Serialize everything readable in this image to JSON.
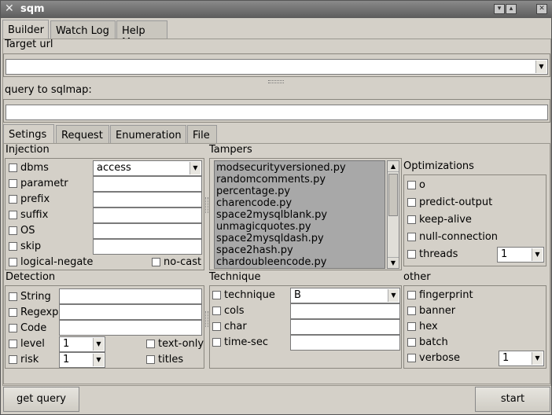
{
  "window": {
    "title": "sqm"
  },
  "main_tabs": [
    "Builder",
    "Watch Log",
    "Help Me"
  ],
  "target_url": {
    "label": "Target url",
    "value": ""
  },
  "query": {
    "label": "query to sqlmap:",
    "value": ""
  },
  "sub_tabs": [
    "Setings",
    "Request",
    "Enumeration",
    "File"
  ],
  "injection": {
    "title": "Injection",
    "dbms_label": "dbms",
    "dbms_value": "access",
    "parametr_label": "parametr",
    "prefix_label": "prefix",
    "suffix_label": "suffix",
    "os_label": "OS",
    "skip_label": "skip",
    "logical_negate_label": "logical-negate",
    "no_cast_label": "no-cast"
  },
  "tampers": {
    "title": "Tampers",
    "items": [
      "modsecurityversioned.py",
      "randomcomments.py",
      "percentage.py",
      "charencode.py",
      "space2mysqlblank.py",
      "unmagicquotes.py",
      "space2mysqldash.py",
      "space2hash.py",
      "chardoubleencode.py"
    ]
  },
  "optimizations": {
    "title": "Optimizations",
    "o_label": "o",
    "predict_output_label": "predict-output",
    "keep_alive_label": "keep-alive",
    "null_connection_label": "null-connection",
    "threads_label": "threads",
    "threads_value": "1"
  },
  "detection": {
    "title": "Detection",
    "string_label": "String",
    "regexp_label": "Regexp",
    "code_label": "Code",
    "level_label": "level",
    "level_value": "1",
    "risk_label": "risk",
    "risk_value": "1",
    "text_only_label": "text-only",
    "titles_label": "titles"
  },
  "technique": {
    "title": "Technique",
    "technique_label": "technique",
    "technique_value": "B",
    "cols_label": "cols",
    "char_label": "char",
    "time_sec_label": "time-sec"
  },
  "other": {
    "title": "other",
    "fingerprint_label": "fingerprint",
    "banner_label": "banner",
    "hex_label": "hex",
    "batch_label": "batch",
    "verbose_label": "verbose",
    "verbose_value": "1"
  },
  "buttons": {
    "get_query": "get query",
    "start": "start"
  },
  "icons": {
    "app": "sqm-logo-icon",
    "minimize": "minimize-icon",
    "maximize": "maximize-icon",
    "close": "close-icon",
    "dropdown": "chevron-down-icon"
  }
}
